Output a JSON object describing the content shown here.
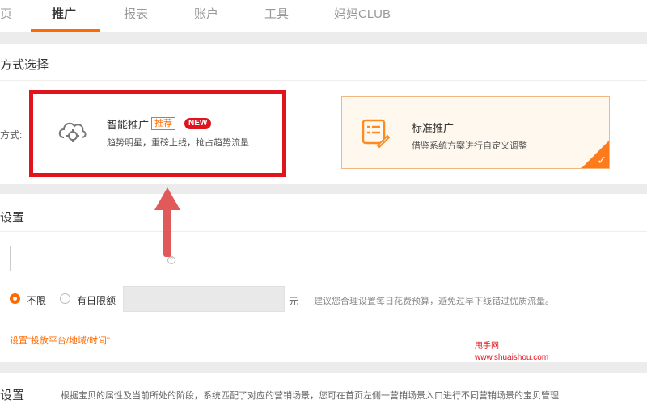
{
  "nav": {
    "tabs": [
      {
        "label": "页"
      },
      {
        "label": "推广"
      },
      {
        "label": "报表"
      },
      {
        "label": "账户"
      },
      {
        "label": "工具"
      },
      {
        "label": "妈妈CLUB"
      }
    ]
  },
  "section1": {
    "title": "方式选择",
    "row_label": "方式:",
    "smart_card": {
      "icon": "cloud-gear-icon",
      "title": "智能推广",
      "badge_recommend": "推荐",
      "badge_new": "NEW",
      "desc": "趋势明星，重磅上线，抢占趋势流量"
    },
    "standard_card": {
      "icon": "document-edit-icon",
      "title": "标准推广",
      "desc": "借鉴系统方案进行自定义调整",
      "selected": true
    }
  },
  "section2": {
    "title": "设置",
    "name_input_value": "",
    "budget": {
      "option_unlimited": "不限",
      "option_daily": "有日限额",
      "selected": "不限",
      "amount_value": "",
      "unit": "元",
      "hint": "建议您合理设置每日花费预算，避免过早下线错过优质流量。"
    },
    "settings_link": "设置\"投放平台/地域/时间\""
  },
  "section3": {
    "title": "设置",
    "desc": "根据宝贝的属性及当前所处的阶段，系统匹配了对应的营销场景，您可在首页左侧一营销场景入口进行不同营销场景的宝贝管理"
  },
  "watermark": {
    "line1": "甩手网",
    "line2": "www.shuaishou.com"
  },
  "colors": {
    "accent": "#ff6a00",
    "highlight_red": "#e0141c",
    "arrow": "#e05a5a"
  }
}
